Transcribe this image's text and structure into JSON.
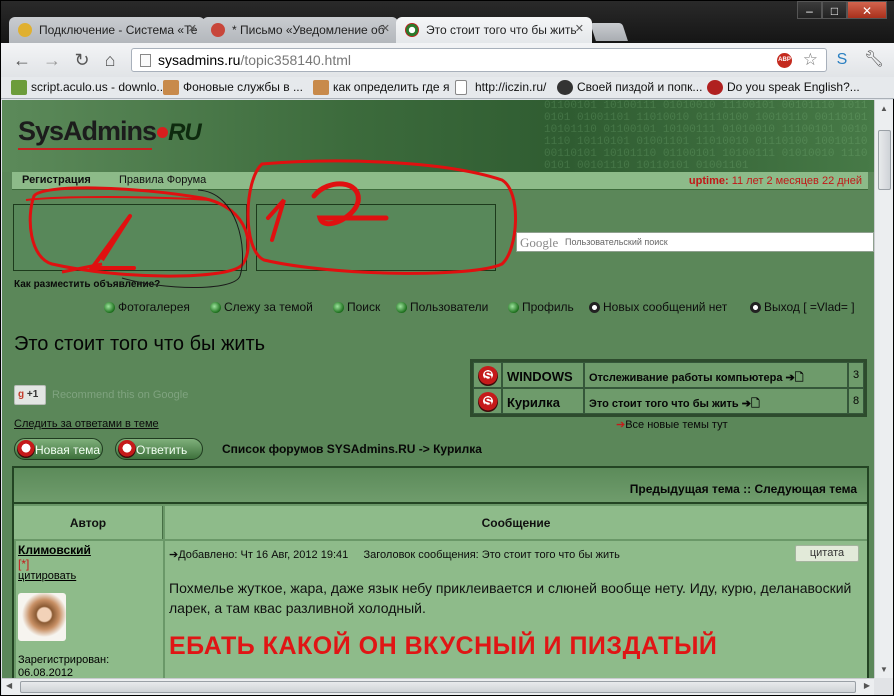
{
  "browser": {
    "tabs": [
      {
        "title": "Подключение - Система «Те",
        "icon_color": "#e0b030"
      },
      {
        "title": "* Письмо «Уведомление об",
        "icon_color": "#c8463a"
      },
      {
        "title": "Это стоит того что бы жить",
        "icon_color": "#2b7a2b",
        "active": true
      }
    ],
    "url_domain": "sysadmins.ru",
    "url_path": "/topic358140.html",
    "window_buttons": [
      "–",
      "□",
      "✕"
    ],
    "bookmarks": [
      {
        "label": "script.aculo.us - downlo...",
        "icon_color": "#6c9c3a"
      },
      {
        "label": "Фоновые службы в ...",
        "icon_color": "#c88a4a"
      },
      {
        "label": "как определить где я",
        "icon_color": "#c88a4a"
      },
      {
        "label": "http://iczin.ru/",
        "icon_color": "#ffffff"
      },
      {
        "label": "Своей пиздой и попк...",
        "icon_color": "#333333"
      },
      {
        "label": "Do you speak English?...",
        "icon_color": "#b02020"
      }
    ],
    "abp_label": "ABP"
  },
  "site": {
    "logo_main": "SysAdmins",
    "logo_ru": "RU",
    "nav_register": "Регистрация",
    "nav_rules": "Правила Форума",
    "uptime_label": "uptime:",
    "uptime_value": "11 лет 2 месяцев 22 дней",
    "search_placeholder": "Пользовательский поиск",
    "search_logo": "Google",
    "how_to_ad": "Как разместить объявление?",
    "menu": [
      "Фотогалерея",
      "Слежу за темой",
      "Поиск",
      "Пользователи",
      "Профиль",
      "Новых сообщений нет",
      "Выход [ =Vlad= ]"
    ],
    "topic_title": "Это стоит того что бы жить",
    "gplus_label": "+1",
    "recommend": "Recommend this on Google",
    "follow_link": "Следить за ответами в теме",
    "recent_topics": [
      {
        "forum": "WINDOWS",
        "topic": "Отслеживание работы компьютера",
        "count": "3"
      },
      {
        "forum": "Курилка",
        "topic": "Это стоит того что бы жить",
        "count": "8"
      }
    ],
    "all_new": "Все новые темы тут",
    "btn_new_topic": "Новая тема",
    "btn_reply": "Ответить",
    "breadcrumbs": "Список форумов SYSAdmins.RU -> Курилка",
    "prev_next": "Предыдущая тема :: Следующая тема",
    "col_author": "Автор",
    "col_message": "Сообщение"
  },
  "post": {
    "author": "Климовский",
    "rank": "[*]",
    "quote_link": "цитировать",
    "registered_label": "Зарегистрирован:",
    "registered_date": "06.08.2012",
    "meta": "Добавлено: Чт 16 Авг, 2012 19:41     Заголовок сообщения: Это стоит того что бы жить",
    "cite_button": "цитата",
    "body": "Похмелье жуткое, жара, даже язык небу приклеивается и слюней вообще нету. Иду, курю, деланавоский ларек, а там квас разливной холодный.",
    "big_text": "ЕБАТЬ КАКОЙ ОН ВКУСНЫЙ И ПИЗДАТЫЙ"
  },
  "annotations": {
    "label_1": "1",
    "label_2": "2",
    "color": "#e01010"
  }
}
